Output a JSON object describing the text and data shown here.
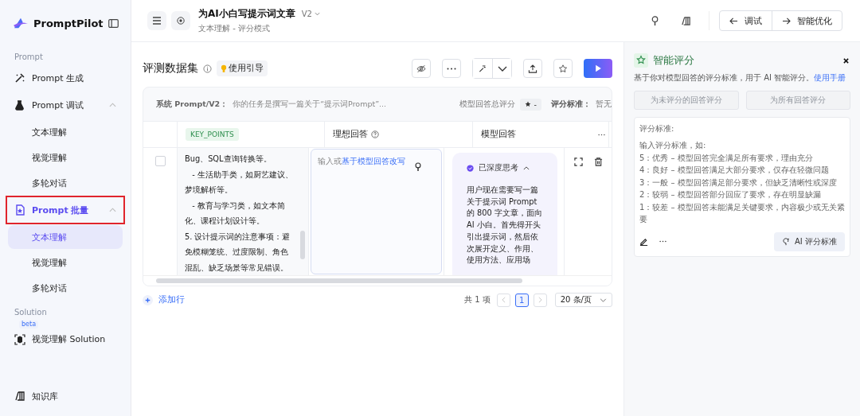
{
  "brand": {
    "name": "PromptPilot"
  },
  "sidebar": {
    "sections": [
      {
        "title": "Prompt",
        "items": [
          {
            "label": "Prompt 生成",
            "highlighted": false
          },
          {
            "label": "Prompt 调试",
            "expanded": true,
            "highlighted": false,
            "children": [
              {
                "label": "文本理解",
                "selected": false
              },
              {
                "label": "视觉理解",
                "selected": false
              },
              {
                "label": "多轮对话",
                "selected": false
              }
            ]
          },
          {
            "label": "Prompt 批量",
            "expanded": true,
            "highlighted": true,
            "children": [
              {
                "label": "文本理解",
                "selected": true
              },
              {
                "label": "视觉理解",
                "selected": false
              },
              {
                "label": "多轮对话",
                "selected": false
              }
            ]
          }
        ]
      },
      {
        "title": "Solution",
        "items": [
          {
            "label": "视觉理解 Solution",
            "badge": "beta",
            "highlighted": false
          }
        ]
      }
    ],
    "footer_item": {
      "label": "知识库"
    }
  },
  "header": {
    "title": "为AI小白写提示词文章",
    "version": "V2",
    "subtitle": "文本理解 - 评分模式",
    "nav_buttons": [
      {
        "label": "调试"
      },
      {
        "label": "智能优化"
      }
    ]
  },
  "dataset": {
    "title": "评测数据集",
    "guide_button": "使用引导",
    "system_prompt_label": "系统 Prompt/V2：",
    "system_prompt": "你的任务是撰写一篇关于“提示词Prompt”...",
    "total_score_label": "模型回答总评分",
    "total_score": "-",
    "criteria_label": "评分标准：",
    "criteria_value": "暂无",
    "columns": [
      {
        "label": "KEY_POINTS",
        "kind": "tag"
      },
      {
        "label": "理想回答",
        "kind": "help"
      },
      {
        "label": "模型回答",
        "kind": "more"
      }
    ],
    "row": {
      "checked": false,
      "key_points": [
        "Bug、SQL查询转换等。",
        "   - 生活助手类，如厨艺建议、",
        "梦境解析等。",
        "   - 教育与学习类，如文本简",
        "化、课程计划设计等。",
        "5. 设计提示词的注意事项：避",
        "免模糊笼统、过度限制、角色",
        "混乱、缺乏场景等常见错误。"
      ],
      "ideal_placeholder": "输入或",
      "ideal_link": "基于模型回答改写",
      "thinking_label": "已深度思考",
      "thinking_expanded": true,
      "model_answer": [
        "用户现在需要写一篇",
        "关于提示词 Prompt",
        "的 800 字文章，面向",
        "AI 小白。首先得开头",
        "引出提示词，然后依",
        "次展开定义、作用、",
        "使用方法、应用场"
      ]
    },
    "add_row": "添加行",
    "total": "共 1 项",
    "pages": [
      {
        "label": "1",
        "selected": true
      }
    ],
    "page_size": "20 条/页"
  },
  "panel": {
    "title": "智能评分",
    "description": "基于你对模型回答的评分标准，用于 AI 智能评分。",
    "manual_link": "使用手册",
    "buttons": [
      {
        "label": "为未评分的回答评分",
        "disabled": true
      },
      {
        "label": "为所有回答评分",
        "disabled": true
      }
    ],
    "criteria_title": "评分标准:",
    "criteria_lines": [
      "输入评分标准，如:",
      "5：优秀 – 模型回答完全满足所有要求，理由充分",
      "4：良好 – 模型回答满足大部分要求，仅存在轻微问题",
      "3：一般 – 模型回答满足部分要求，但缺乏清晰性或深度",
      "2：较弱 – 模型回答部分回应了要求，存在明显缺漏",
      "1：较差 – 模型回答未能满足关键要求，内容极少或无关紧要"
    ],
    "ai_button": "AI 评分标准"
  }
}
